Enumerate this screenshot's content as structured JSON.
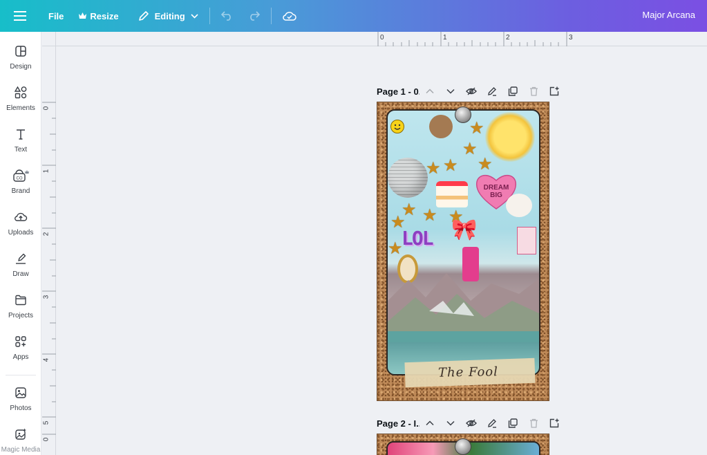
{
  "topbar": {
    "file_label": "File",
    "resize_label": "Resize",
    "editing_label": "Editing",
    "design_title": "Major Arcana"
  },
  "sidebar": {
    "items": [
      {
        "label": "Design",
        "icon": "layout-icon"
      },
      {
        "label": "Elements",
        "icon": "shapes-icon"
      },
      {
        "label": "Text",
        "icon": "text-icon"
      },
      {
        "label": "Brand",
        "icon": "brand-icon"
      },
      {
        "label": "Uploads",
        "icon": "cloud-upload-icon"
      },
      {
        "label": "Draw",
        "icon": "pen-icon"
      },
      {
        "label": "Projects",
        "icon": "folder-icon"
      },
      {
        "label": "Apps",
        "icon": "apps-icon"
      },
      {
        "label": "Photos",
        "icon": "image-icon"
      },
      {
        "label": "Magic Media",
        "icon": "magic-icon"
      }
    ]
  },
  "ruler": {
    "top_ticks": [
      "0",
      "1",
      "2",
      "3"
    ],
    "left_ticks": [
      "0",
      "1",
      "2",
      "3",
      "4",
      "5",
      "0"
    ]
  },
  "pages": [
    {
      "title": "Page 1 - 0..",
      "card_text": "The Fool",
      "card_sticker_text": "DREAM BIG",
      "lol_text": "LOL"
    },
    {
      "title": "Page 2 - I..."
    }
  ],
  "colors": {
    "topbar_start": "#17bec9",
    "topbar_end": "#7b4fe3",
    "cork": "#bf8a58"
  }
}
